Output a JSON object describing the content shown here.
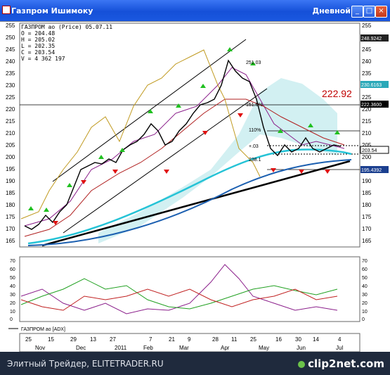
{
  "window": {
    "title": "Газпром Ишимоку",
    "period": "Дневной",
    "buttons": [
      "_",
      "□",
      "×"
    ]
  },
  "info": [
    "ГАЗПРОМ ао (Price) 05.07.11",
    "O = 204.48",
    "H = 205.02",
    "L = 202.35",
    "C = 203.54",
    "V = 4 362 197"
  ],
  "price_axis": [
    "255",
    "250",
    "245",
    "240",
    "235",
    "230",
    "225",
    "220",
    "215",
    "210",
    "205",
    "200",
    "195",
    "190",
    "185",
    "180",
    "175",
    "170",
    "165"
  ],
  "right_tags": [
    "248.9242",
    "230.6163",
    "222.3600",
    "203.54",
    "195.4392"
  ],
  "big_label": "222.92",
  "annotations": [
    "251.03",
    "151.6%",
    "110%",
    "+.03",
    "238.1"
  ],
  "adx_axis": [
    "70",
    "60",
    "50",
    "40",
    "30",
    "20",
    "10",
    "0"
  ],
  "adx_legend": "ГАЗПРОМ ао [ADX]",
  "date_ticks": [
    "25",
    "15",
    "29",
    "13",
    "27",
    "7",
    "21",
    "9",
    "28",
    "11",
    "25",
    "16",
    "30",
    "14",
    "4"
  ],
  "month_ticks": [
    "Nov",
    "Dec",
    "2011",
    "Feb",
    "Mar",
    "Apr",
    "May",
    "Jun",
    "Jul"
  ],
  "footer": {
    "text": "Элитный Трейдер, ELITETRADER.RU",
    "brand": "clip2net.com"
  },
  "colors": {
    "title_bar": "#1f5ce6",
    "big_label": "#c00000",
    "up_marker": "#20c020",
    "down_marker": "#e01010"
  }
}
